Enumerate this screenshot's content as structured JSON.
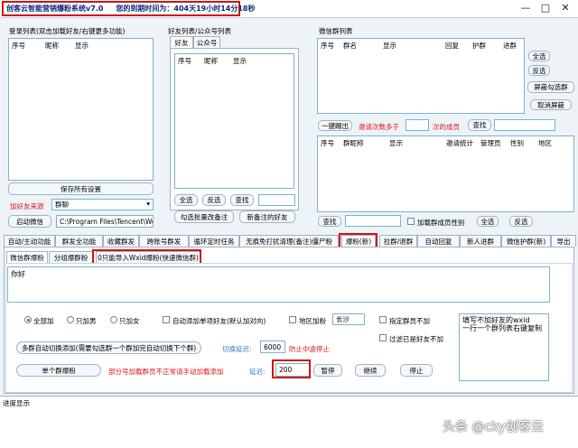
{
  "window": {
    "app_title": "创客云智能营销爆粉系统v7.0",
    "expiry_label": "您的到期时间为：",
    "expiry_value": "404天19小时14分18秒"
  },
  "login": {
    "title": "登录列表(双击加载好友/右键更多功能)",
    "columns": [
      "序号",
      "昵称",
      "显示"
    ],
    "save_settings": "保存所有设置",
    "friend_source_label": "加好友来源",
    "friend_source_value": "群聊",
    "start_wechat": "启动微信",
    "wechat_path": "C:\\Program Files\\Tencent\\WeC"
  },
  "friends": {
    "title": "好友列表/公众号列表",
    "tabs": [
      "好友",
      "公众号"
    ],
    "columns": [
      "序号",
      "昵称",
      "显示"
    ],
    "select_all": "全选",
    "invert": "反选",
    "search": "查找",
    "check_batch": "勾选批量改备注",
    "new_remark": "新备注的好友"
  },
  "groups": {
    "title": "微信群列表",
    "columns": [
      "序号",
      "群名",
      "显示",
      "回复",
      "护群",
      "进群"
    ],
    "select_all": "全选",
    "invert": "反选",
    "block_group": "屏蔽勾选群",
    "unblock": "取消屏蔽",
    "kick_once": "一键踢出",
    "invite_count_label": "邀请次数多于",
    "times_members": "次的成员",
    "search": "查找"
  },
  "members": {
    "columns": [
      "序号",
      "群昵称",
      "显示",
      "邀请统计",
      "管理员",
      "性别",
      "地区"
    ],
    "search": "查找",
    "load_gender_label": "加载群成员性别",
    "select_all": "全选",
    "invert": "反选"
  },
  "main_tabs": [
    "自动/主动功能",
    "群发全功能",
    "收藏群发",
    "跨账号群发",
    "循环定时任务",
    "无痕免打扰清理(备注)僵尸粉",
    "爆粉(新)",
    "拉群/退群",
    "自动回复",
    "新人进群",
    "微信护群(新)",
    "导出"
  ],
  "sub_tabs": [
    "微信群爆粉",
    "分组爆群粉",
    "0只能导入Wxid爆粉(快速微信群)"
  ],
  "form": {
    "greeting_label": "你好",
    "radio_all": "全部加",
    "radio_male": "只加男",
    "radio_female": "只加女",
    "auto_add_remark": "自动添加单项好友(默认加对向)",
    "region_add": "地区加粉",
    "region_value": "长沙",
    "specify_members": "指定群员不加",
    "filter_added": "过滤已是好友不加",
    "notes_line1": "填写不加好友的wxid",
    "notes_line2": "一行一个群列表右键复制",
    "multi_group_button": "多群自动切换添加(需要勾选群一个群加完自动切换下个群)",
    "switch_delay_label": "切换延迟:",
    "switch_delay_value": "6000",
    "anti_stop_label": "防止中途停止",
    "single_group_button": "单个群爆粉",
    "warning_text": "部分号加载群员不正常请手动加载添加",
    "delay_label": "延迟:",
    "delay_value": "200",
    "pause": "暂停",
    "continue": "继续",
    "stop": "停止"
  },
  "progress": {
    "label": "进度显示"
  },
  "watermark": "头条 @cky创客云"
}
